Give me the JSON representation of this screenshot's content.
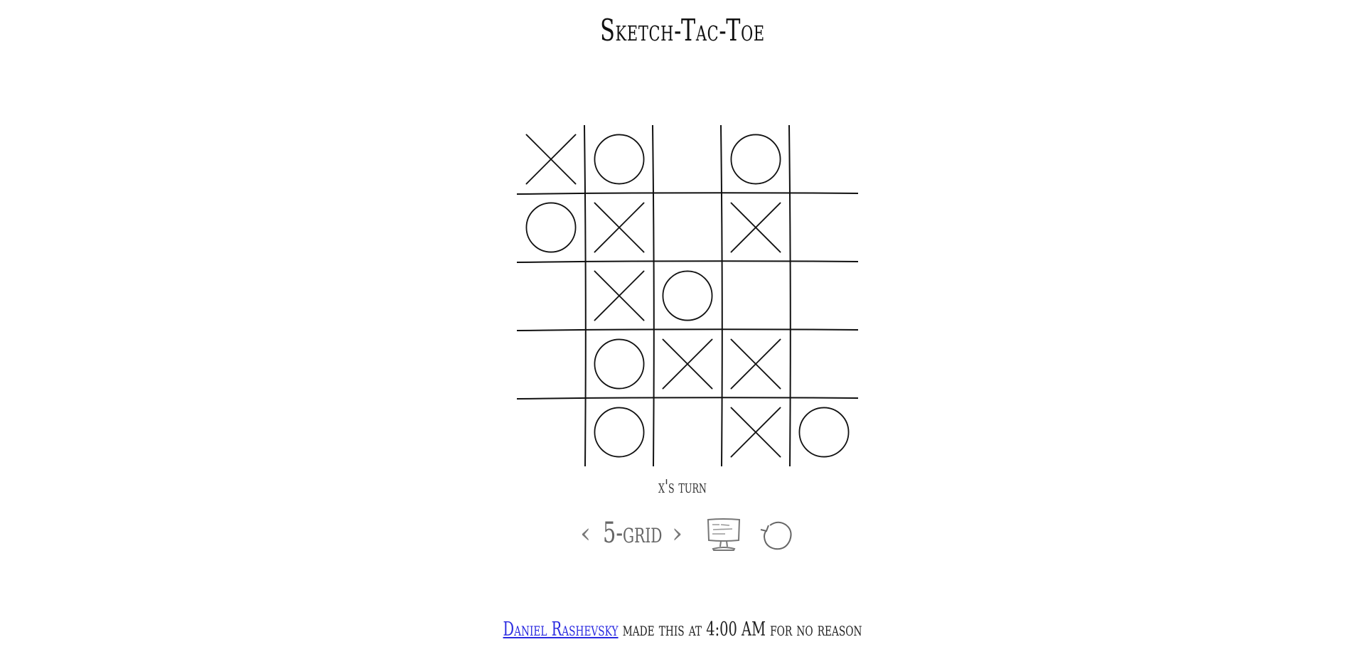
{
  "title": "Sketch-Tac-Toe",
  "board": {
    "size": 5,
    "cells": [
      [
        "X",
        "O",
        "",
        "O",
        ""
      ],
      [
        "O",
        "X",
        "",
        "X",
        ""
      ],
      [
        "",
        "X",
        "O",
        "",
        ""
      ],
      [
        "",
        "O",
        "X",
        "X",
        ""
      ],
      [
        "",
        "O",
        "",
        "X",
        "O"
      ]
    ]
  },
  "status": "x's turn",
  "controls": {
    "prev_label": "‹",
    "grid_label": "5-grid",
    "next_label": "›",
    "computer_icon": "computer-icon",
    "restart_icon": "restart-icon"
  },
  "footer": {
    "author": "Daniel Rashevsky",
    "text": "made this at 4:00 AM for no reason"
  }
}
